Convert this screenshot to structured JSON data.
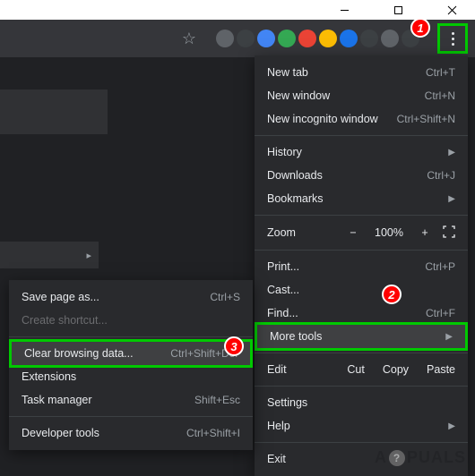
{
  "title_bar": {
    "minimize": "minimize",
    "maximize": "maximize",
    "close": "close"
  },
  "toolbar": {
    "star": "☆"
  },
  "markers": {
    "m1": "1",
    "m2": "2",
    "m3": "3"
  },
  "main_menu": {
    "new_tab": {
      "label": "New tab",
      "shortcut": "Ctrl+T"
    },
    "new_window": {
      "label": "New window",
      "shortcut": "Ctrl+N"
    },
    "new_incognito": {
      "label": "New incognito window",
      "shortcut": "Ctrl+Shift+N"
    },
    "history": {
      "label": "History"
    },
    "downloads": {
      "label": "Downloads",
      "shortcut": "Ctrl+J"
    },
    "bookmarks": {
      "label": "Bookmarks"
    },
    "zoom": {
      "label": "Zoom",
      "minus": "−",
      "value": "100%",
      "plus": "+"
    },
    "print": {
      "label": "Print...",
      "shortcut": "Ctrl+P"
    },
    "cast": {
      "label": "Cast..."
    },
    "find": {
      "label": "Find...",
      "shortcut": "Ctrl+F"
    },
    "more_tools": {
      "label": "More tools"
    },
    "edit": {
      "label": "Edit",
      "cut": "Cut",
      "copy": "Copy",
      "paste": "Paste"
    },
    "settings": {
      "label": "Settings"
    },
    "help": {
      "label": "Help"
    },
    "exit": {
      "label": "Exit"
    }
  },
  "sub_menu": {
    "save_page": {
      "label": "Save page as...",
      "shortcut": "Ctrl+S"
    },
    "create_shortcut": {
      "label": "Create shortcut..."
    },
    "clear_browsing": {
      "label": "Clear browsing data...",
      "shortcut": "Ctrl+Shift+Del"
    },
    "extensions": {
      "label": "Extensions"
    },
    "task_manager": {
      "label": "Task manager",
      "shortcut": "Shift+Esc"
    },
    "developer_tools": {
      "label": "Developer tools",
      "shortcut": "Ctrl+Shift+I"
    }
  },
  "watermark": {
    "pre": "A",
    "q": "?",
    "post": "PUALS"
  }
}
